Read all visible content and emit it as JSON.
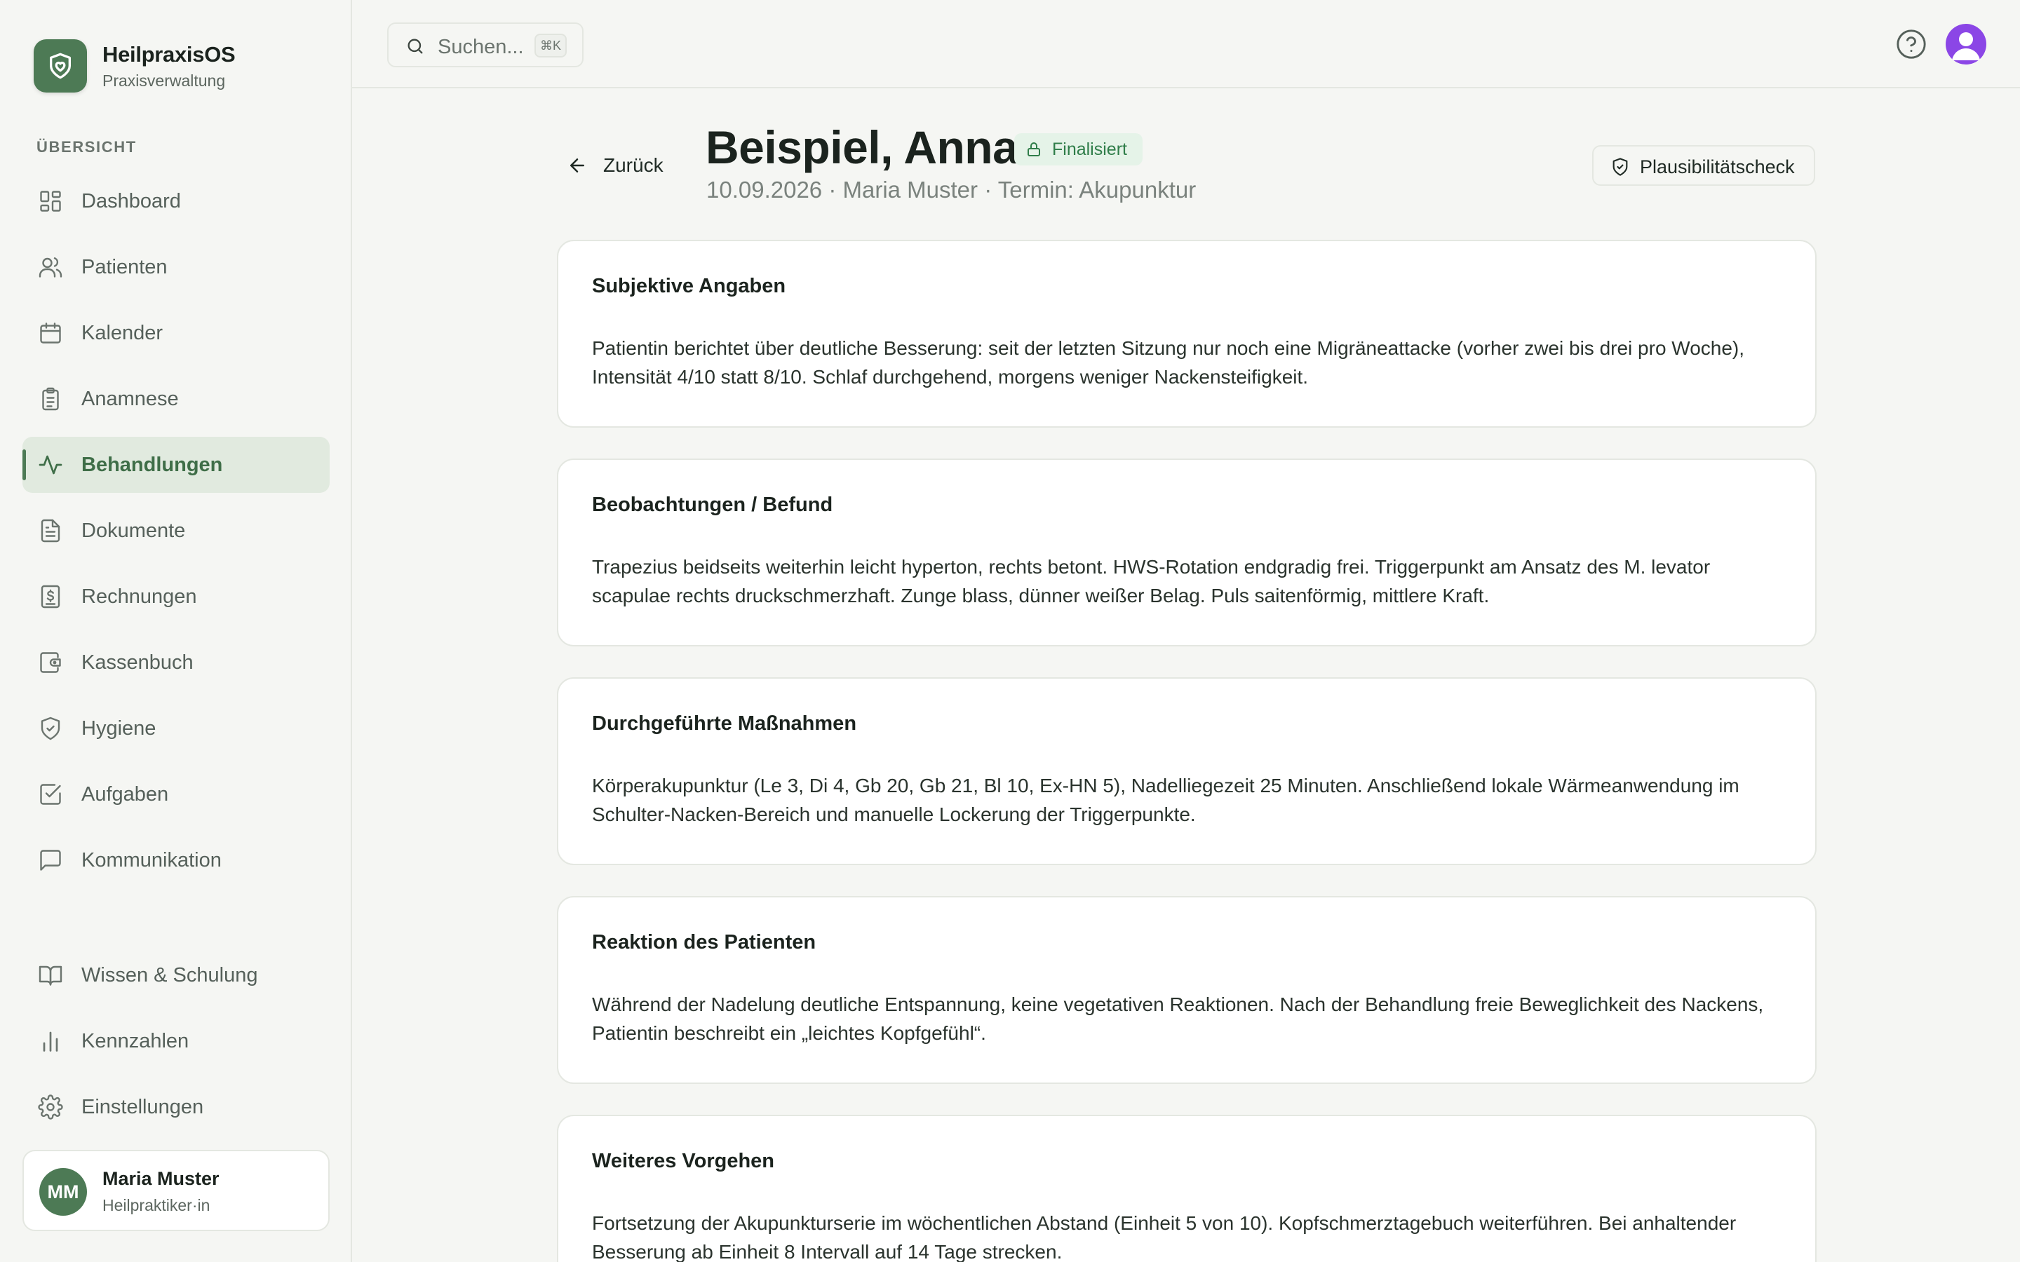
{
  "brand": {
    "name": "HeilpraxisOS",
    "subtitle": "Praxisverwaltung"
  },
  "sidebar": {
    "section_label": "ÜBERSICHT",
    "items": [
      {
        "label": "Dashboard",
        "icon": "dashboard-icon"
      },
      {
        "label": "Patienten",
        "icon": "users-icon"
      },
      {
        "label": "Kalender",
        "icon": "calendar-icon"
      },
      {
        "label": "Anamnese",
        "icon": "clipboard-icon"
      },
      {
        "label": "Behandlungen",
        "icon": "activity-icon",
        "active": true
      },
      {
        "label": "Dokumente",
        "icon": "document-icon"
      },
      {
        "label": "Rechnungen",
        "icon": "invoice-icon"
      },
      {
        "label": "Kassenbuch",
        "icon": "wallet-icon"
      },
      {
        "label": "Hygiene",
        "icon": "shield-icon"
      },
      {
        "label": "Aufgaben",
        "icon": "checkbox-icon"
      },
      {
        "label": "Kommunikation",
        "icon": "message-icon"
      }
    ],
    "bottom_items": [
      {
        "label": "Wissen & Schulung",
        "icon": "book-icon"
      },
      {
        "label": "Kennzahlen",
        "icon": "bar-chart-icon"
      },
      {
        "label": "Einstellungen",
        "icon": "gear-icon"
      }
    ],
    "user": {
      "initials": "MM",
      "name": "Maria Muster",
      "role": "Heilpraktiker·in"
    }
  },
  "topbar": {
    "search_placeholder": "Suchen...",
    "search_shortcut": "⌘K"
  },
  "header": {
    "back_label": "Zurück",
    "patient_name": "Beispiel, Anna",
    "status": "Finalisiert",
    "meta": "10.09.2026 · Maria Muster · Termin: Akupunktur",
    "check_label": "Plausibilitätscheck"
  },
  "sections": [
    {
      "title": "Subjektive Angaben",
      "body": "Patientin berichtet über deutliche Besserung: seit der letzten Sitzung nur noch eine Migräneattacke (vorher zwei bis drei pro Woche), Intensität 4/10 statt 8/10. Schlaf durchgehend, morgens weniger Nackensteifigkeit."
    },
    {
      "title": "Beobachtungen / Befund",
      "body": "Trapezius beidseits weiterhin leicht hyperton, rechts betont. HWS-Rotation endgradig frei. Triggerpunkt am Ansatz des M. levator scapulae rechts druckschmerzhaft. Zunge blass, dünner weißer Belag. Puls saitenförmig, mittlere Kraft."
    },
    {
      "title": "Durchgeführte Maßnahmen",
      "body": "Körperakupunktur (Le 3, Di 4, Gb 20, Gb 21, Bl 10, Ex-HN 5), Nadelliegezeit 25 Minuten. Anschließend lokale Wärmeanwendung im Schulter-Nacken-Bereich und manuelle Lockerung der Triggerpunkte."
    },
    {
      "title": "Reaktion des Patienten",
      "body": "Während der Nadelung deutliche Entspannung, keine vegetativen Reaktionen. Nach der Behandlung freie Beweglichkeit des Nackens, Patientin beschreibt ein „leichtes Kopfgefühl“."
    },
    {
      "title": "Weiteres Vorgehen",
      "body": "Fortsetzung der Akupunkturserie im wöchentlichen Abstand (Einheit 5 von 10). Kopfschmerztagebuch weiterführen. Bei anhaltender Besserung ab Einheit 8 Intervall auf 14 Tage strecken."
    }
  ]
}
